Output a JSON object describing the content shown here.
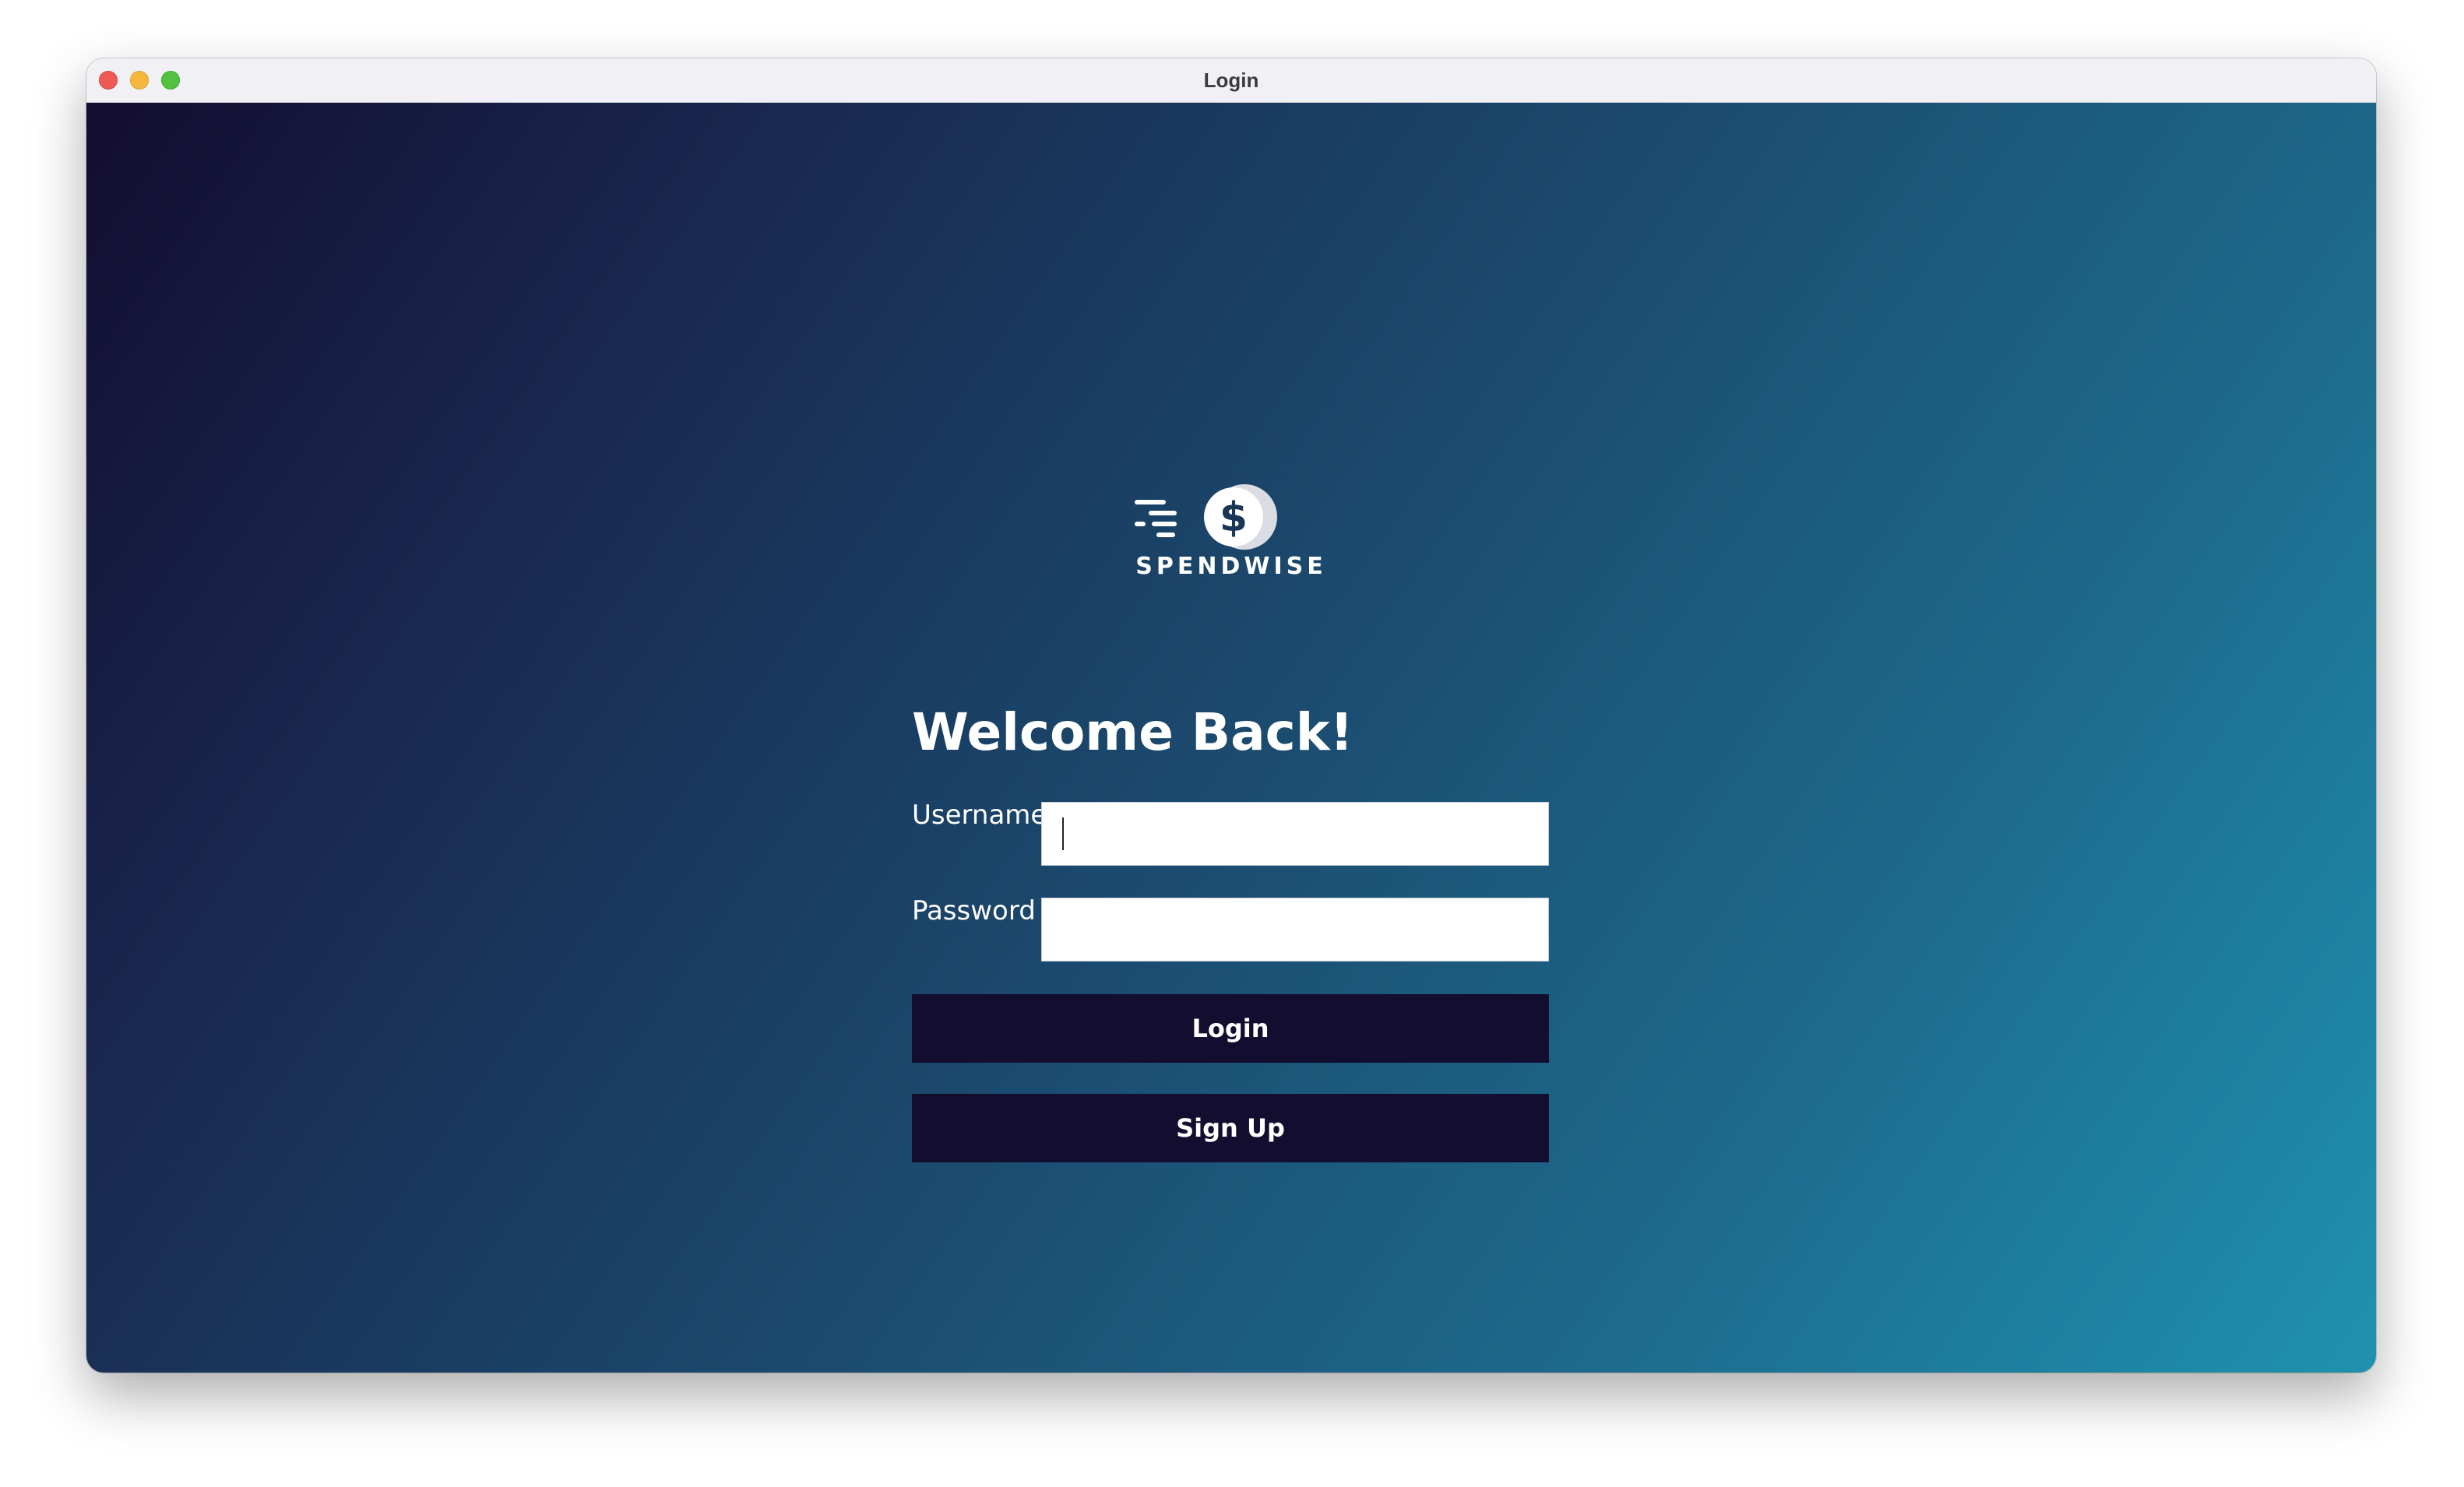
{
  "window": {
    "title": "Login"
  },
  "brand": {
    "name": "SPENDWISE",
    "logo_icon": "dollar-coin-speed-icon"
  },
  "login_form": {
    "heading": "Welcome Back!",
    "username_label": "Username",
    "username_value": "",
    "password_label": "Password",
    "password_value": "",
    "login_label": "Login",
    "signup_label": "Sign Up"
  },
  "colors": {
    "button_bg": "#130d30",
    "gradient_start": "#130d30",
    "gradient_end": "#1f92b0",
    "text": "#ffffff"
  }
}
